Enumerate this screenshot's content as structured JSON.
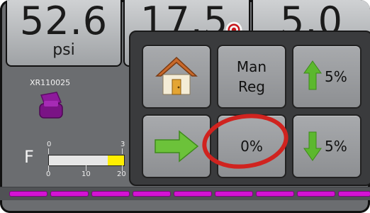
{
  "gauges": [
    {
      "value": "52.6",
      "unit": "psi"
    },
    {
      "value": "17.5"
    },
    {
      "value": "5.0"
    }
  ],
  "nozzle_label": "XR110025",
  "flow": {
    "letter": "F",
    "top_ticks": [
      "0",
      "3"
    ],
    "bottom_ticks": [
      "0",
      "10",
      "20"
    ],
    "fill_fraction": 0.22
  },
  "menu": {
    "man_reg_line1": "Man",
    "man_reg_line2": "Reg",
    "rate_display": "0%",
    "increase_label": "5%",
    "decrease_label": "5%"
  },
  "colors": {
    "accent_magenta": "#d413d4",
    "gauge_yellow": "#ffee00",
    "annotation_red": "#d0231f",
    "arrow_green": "#5cb82e"
  },
  "icons": {
    "home": "home-icon",
    "next": "arrow-right-icon",
    "up": "arrow-up-icon",
    "down": "arrow-down-icon",
    "target": "target-icon",
    "nozzle": "nozzle-icon"
  }
}
